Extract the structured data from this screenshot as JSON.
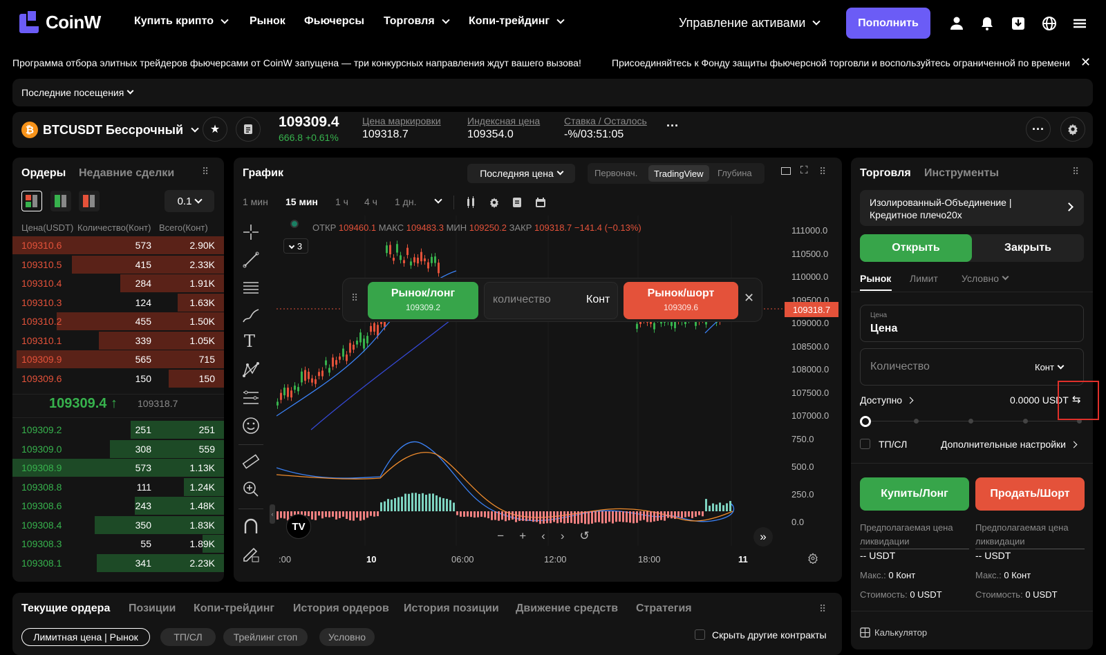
{
  "nav": {
    "logo": "CoinW",
    "items": [
      "Купить крипто",
      "Рынок",
      "Фьючерсы",
      "Торговля",
      "Копи-трейдинг"
    ],
    "assets": "Управление активами",
    "deposit": "Пополнить"
  },
  "ticker": {
    "msg1": "Программа отбора элитных трейдеров фьючерсами от CoinW запущена — три конкурсных направления ждут вашего вызова!",
    "msg2": "Присоединяйтесь к Фонду защиты фьючерсной торговли и воспользуйтесь ограниченной по времени"
  },
  "recent": "Последние посещения",
  "symbol": {
    "name": "BTCUSDT Бессрочный",
    "price": "109309.4",
    "change": "666.8 +0.61%",
    "mark_label": "Цена маркировки",
    "mark": "109318.7",
    "index_label": "Индексная цена",
    "index": "109354.0",
    "rate_label": "Ставка / Осталось",
    "rate": "-%/03:51:05"
  },
  "orderbook": {
    "tab1": "Ордеры",
    "tab2": "Недавние сделки",
    "step": "0.1",
    "h_price": "Цена(USDT)",
    "h_qty": "Количество(Конт)",
    "h_total": "Всего(Конт)",
    "asks": [
      {
        "p": "109310.6",
        "q": "573",
        "t": "2.90K",
        "d": 1.0
      },
      {
        "p": "109310.5",
        "q": "415",
        "t": "2.33K",
        "d": 0.72
      },
      {
        "p": "109310.4",
        "q": "284",
        "t": "1.91K",
        "d": 0.49
      },
      {
        "p": "109310.3",
        "q": "124",
        "t": "1.63K",
        "d": 0.22
      },
      {
        "p": "109310.2",
        "q": "455",
        "t": "1.50K",
        "d": 0.79
      },
      {
        "p": "109310.1",
        "q": "339",
        "t": "1.05K",
        "d": 0.59
      },
      {
        "p": "109309.9",
        "q": "565",
        "t": "715",
        "d": 0.98
      },
      {
        "p": "109309.6",
        "q": "150",
        "t": "150",
        "d": 0.26
      }
    ],
    "mid": "109309.4",
    "mid_mark": "109318.7",
    "bids": [
      {
        "p": "109309.2",
        "q": "251",
        "t": "251",
        "d": 0.44
      },
      {
        "p": "109309.0",
        "q": "308",
        "t": "559",
        "d": 0.54
      },
      {
        "p": "109308.9",
        "q": "573",
        "t": "1.13K",
        "d": 1.0
      },
      {
        "p": "109308.8",
        "q": "111",
        "t": "1.24K",
        "d": 0.19
      },
      {
        "p": "109308.6",
        "q": "243",
        "t": "1.48K",
        "d": 0.42
      },
      {
        "p": "109308.4",
        "q": "350",
        "t": "1.83K",
        "d": 0.61
      },
      {
        "p": "109308.3",
        "q": "55",
        "t": "1.89K",
        "d": 0.1
      },
      {
        "p": "109308.1",
        "q": "341",
        "t": "2.23K",
        "d": 0.6
      }
    ]
  },
  "chart": {
    "title": "График",
    "price_type": "Последняя цена",
    "views": [
      "Первонач.",
      "TradingView",
      "Глубина"
    ],
    "tfs": [
      "1 мин",
      "15 мин",
      "1 ч",
      "4 ч",
      "1 дн."
    ],
    "ohlc": {
      "o_l": "ОТКР",
      "o": "109460.1",
      "h_l": "МАКС",
      "h": "109483.3",
      "l_l": "МИН",
      "l": "109250.2",
      "c_l": "ЗАКР",
      "c": "109318.7",
      "chg": "−141.4 (−0.13%)"
    },
    "indicators_count": "3",
    "price_axis": [
      "111000.0",
      "110500.0",
      "110000.0",
      "109500.0",
      "109000.0",
      "108500.0",
      "108000.0",
      "107500.0",
      "107000.0"
    ],
    "macd_axis": [
      "750.0",
      "500.0",
      "250.0",
      "0.0"
    ],
    "last_price": "109318.7",
    "time_axis": [
      ":00",
      "10",
      "06:00",
      "12:00",
      "18:00",
      "11"
    ],
    "quick_long": "Рынок/лонг",
    "quick_long_price": "109309.2",
    "quick_qty": "количество",
    "quick_unit": "Конт",
    "quick_short": "Рынок/шорт",
    "quick_short_price": "109309.6"
  },
  "trade": {
    "tab1": "Торговля",
    "tab2": "Инструменты",
    "mode": "Изолированный-Объединение | Кредитное плечо20x",
    "open": "Открыть",
    "close": "Закрыть",
    "types": [
      "Рынок",
      "Лимит",
      "Условно"
    ],
    "price_small": "Цена",
    "price": "Цена",
    "qty": "Количество",
    "qty_unit": "Конт",
    "available": "Доступно",
    "available_val": "0.0000 USDT",
    "tpsl": "ТП/СЛ",
    "more": "Дополнительные настройки",
    "buy": "Купить/Лонг",
    "sell": "Продать/Шорт",
    "liq": "Предполагаемая цена ликвидации",
    "liq_val": "-- USDT",
    "max_l": "Макс.:",
    "max_v": "0 Конт",
    "cost_l": "Стоимость:",
    "cost_v": "0 USDT",
    "calc": "Калькулятор"
  },
  "bottom": {
    "tabs": [
      "Текущие ордера",
      "Позиции",
      "Копи-трейдинг",
      "История ордеров",
      "История позиции",
      "Движение средств",
      "Стратегия"
    ],
    "filters": [
      "Лимитная цена | Рынок",
      "ТП/СЛ",
      "Трейлинг стоп",
      "Условно"
    ],
    "hide": "Скрыть другие контракты"
  }
}
